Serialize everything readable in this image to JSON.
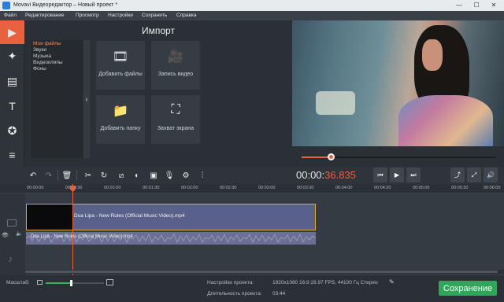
{
  "window": {
    "title": "Movavi Видеоредактор – Новый проект *",
    "minimize": "—",
    "maximize": "☐",
    "close": "✕"
  },
  "menu": [
    "Файл",
    "Редактирование",
    "Просмотр",
    "Настройки",
    "Сохранить",
    "Справка"
  ],
  "left_tools": [
    {
      "icon": "import-icon",
      "glyph": "▶"
    },
    {
      "icon": "magic-wand-icon",
      "glyph": "✦"
    },
    {
      "icon": "filmstrip-icon",
      "glyph": "▤"
    },
    {
      "icon": "titles-icon",
      "glyph": "T"
    },
    {
      "icon": "stickers-star-icon",
      "glyph": "✪"
    },
    {
      "icon": "list-icon",
      "glyph": "≡"
    }
  ],
  "import": {
    "title": "Импорт",
    "categories": [
      "Мои файлы",
      "Звуки",
      "Музыка",
      "Видеоклипы",
      "Фоны"
    ],
    "collapse_glyph": "‹",
    "tiles": [
      {
        "label": "Добавить файлы",
        "glyph": "🎞",
        "icon": "add-files-icon"
      },
      {
        "label": "Запись видео",
        "glyph": "🎥",
        "icon": "record-video-icon"
      },
      {
        "label": "Добавить папку",
        "glyph": "📁",
        "icon": "add-folder-icon"
      },
      {
        "label": "Захват экрана",
        "glyph": "⛶",
        "icon": "screen-capture-icon"
      }
    ]
  },
  "player": {
    "timecode_dim": "00:00:",
    "timecode_active": "36.835",
    "progress": 0.15
  },
  "toolbar": {
    "undo": "↶",
    "redo": "↷",
    "delete": "🗑",
    "cut": "✂",
    "rotate": "↻",
    "crop": "⧄",
    "color": "◐",
    "image": "▣",
    "audio": "🎙",
    "settings": "⚙",
    "equalizer": "⫶",
    "prev": "⏮",
    "play": "▶",
    "next": "⏭",
    "export": "⤴",
    "fullscreen": "⤢",
    "volume": "🔊"
  },
  "ruler": [
    "00:00:00",
    "00:00:30",
    "00:01:00",
    "00:01:30",
    "00:02:00",
    "00:02:30",
    "00:03:00",
    "00:03:30",
    "00:04:00",
    "00:04:30",
    "00:05:00",
    "00:05:30",
    "00:06:00"
  ],
  "timeline": {
    "video_clip": "Dua Lipa - New Rules (Official Music Video).mp4",
    "audio_clip": "Dua Lipa - New Rules (Official Music Video).mp4"
  },
  "status": {
    "zoom_label": "Масштаб:",
    "zoom_level": 0.43,
    "settings_label": "Настройки проекта:",
    "settings_value": "1920x1080 16:9 29.97 FPS, 44100 Гц Стерео",
    "duration_label": "Длительность проекта:",
    "duration_value": "03:44",
    "save_label": "Сохранение"
  },
  "colors": {
    "accent": "#e8623f",
    "save": "#2fa75a",
    "clip_border": "#d9a93a"
  }
}
